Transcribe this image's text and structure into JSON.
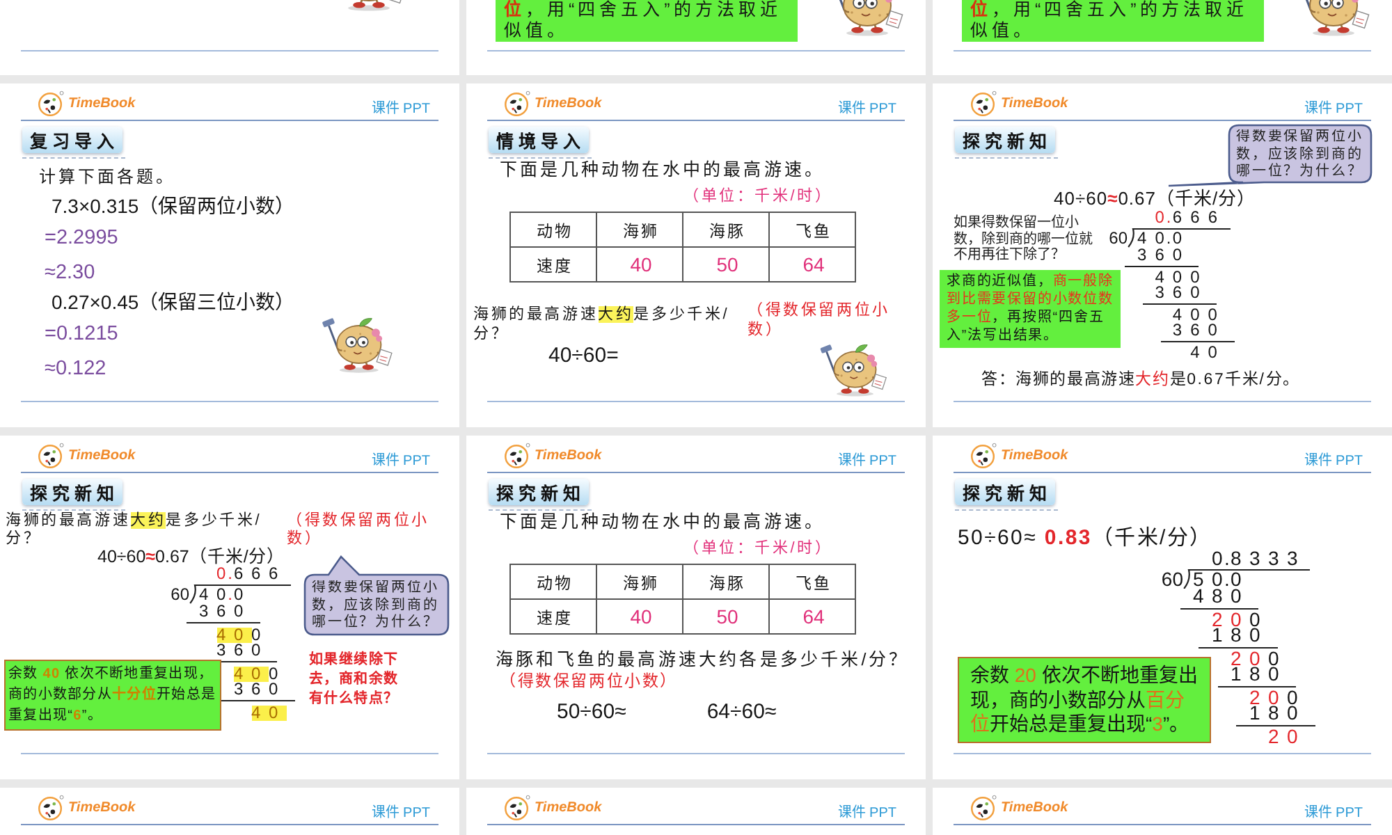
{
  "slides": [
    {
      "kind": "tail",
      "mascot": true
    },
    {
      "kind": "tail",
      "mascot": true,
      "note": {
        "text": "**位**，用“四舍五入”的方法取近似值。",
        "framed": false
      }
    },
    {
      "kind": "tail",
      "mascot": true,
      "note": {
        "text": "**位**，用“四舍五入”的方法取近似值。",
        "framed": false
      }
    },
    {
      "kind": "review",
      "logo": "TimeBook",
      "tag": "课件 PPT",
      "heading": "复习导入",
      "mascot": true,
      "lines": [
        {
          "kind": "prompt",
          "text": "计算下面各题。"
        },
        {
          "kind": "problem",
          "text": "7.3×0.315（保留两位小数）"
        },
        {
          "kind": "answer",
          "text": "=2.2995"
        },
        {
          "kind": "answer",
          "text": "≈2.30"
        },
        {
          "kind": "problem",
          "text": "0.27×0.45（保留三位小数）"
        },
        {
          "kind": "answer",
          "text": "=0.1215"
        },
        {
          "kind": "answer",
          "text": "≈0.122"
        }
      ]
    },
    {
      "kind": "scene",
      "logo": "TimeBook",
      "tag": "课件 PPT",
      "heading": "情境导入",
      "mascot": true,
      "intro": "下面是几种动物在水中的最高游速。",
      "unit": "（单位：千米/时）",
      "table": {
        "columns": [
          "动物",
          "海狮",
          "海豚",
          "飞鱼"
        ],
        "rows": [
          [
            "速度",
            "40",
            "50",
            "64"
          ]
        ]
      },
      "question": "海狮的最高游速**大约**是多少千米/分？",
      "hint": "（得数保留两位小数）",
      "equations": [
        "40÷60="
      ]
    },
    {
      "kind": "solution",
      "logo": "TimeBook",
      "tag": "课件 PPT",
      "heading": "探究新知",
      "bubble": "得数要保留两位小数，应该除到商的哪一位？为什么？",
      "equation": "40÷60**≈**0.67（千米/分）",
      "aside": "如果得数保留一位小数，除到商的哪一位就不用再往下除了？",
      "division": {
        "divisor": "60",
        "dividend": "40.0",
        "quotient": "**0.**666",
        "rows": [
          {
            "kind": "product",
            "digits": "360"
          },
          {
            "kind": "carry",
            "digits": "400"
          },
          {
            "kind": "product",
            "digits": "360"
          },
          {
            "kind": "carry",
            "digits": "400"
          },
          {
            "kind": "product",
            "digits": "360"
          },
          {
            "kind": "rest",
            "digits": "40"
          }
        ]
      },
      "note": {
        "text": "求商的近似值，**商一般除到比需要保留的小数位数多一位**，再按照“四舍五入”法写出结果。",
        "framed": false
      },
      "answer": "答：海狮的最高游速**大约**是0.67千米/分。"
    },
    {
      "kind": "pattern",
      "logo": "TimeBook",
      "tag": "课件 PPT",
      "heading": "探究新知",
      "question": "海狮的最高游速**大约**是多少千米/分？",
      "hint": "（得数保留两位小数）",
      "equation": "40÷60**≈**0.67（千米/分）",
      "bubble": "得数要保留两位小数，应该除到商的哪一位？为什么？",
      "division": {
        "divisor": "60",
        "dividend": "40**.**0",
        "quotient": "**0.**666",
        "rows": [
          {
            "kind": "product",
            "digits": "360"
          },
          {
            "kind": "carry",
            "digits": "**40**0"
          },
          {
            "kind": "product",
            "digits": "360"
          },
          {
            "kind": "carry",
            "digits": "**40**0"
          },
          {
            "kind": "product",
            "digits": "360"
          },
          {
            "kind": "rest",
            "digits": "40"
          }
        ]
      },
      "note": {
        "text": "余数 **40** 依次不断地重复出现，商的小数部分从**十分位**开始总是重复出现“**6**”。",
        "framed": true
      },
      "aside": "如果继续除下去，商和余数有什么特点？"
    },
    {
      "kind": "practice",
      "logo": "TimeBook",
      "tag": "课件 PPT",
      "heading": "探究新知",
      "intro": "下面是几种动物在水中的最高游速。",
      "unit": "（单位：千米/时）",
      "table": {
        "columns": [
          "动物",
          "海狮",
          "海豚",
          "飞鱼"
        ],
        "rows": [
          [
            "速度",
            "40",
            "50",
            "64"
          ]
        ]
      },
      "question": "海豚和飞鱼的最高游速大约各是多少千米/分？",
      "hint": "（得数保留两位小数）",
      "equations": [
        "50÷60≈",
        "64÷60≈"
      ]
    },
    {
      "kind": "result",
      "logo": "TimeBook",
      "tag": "课件 PPT",
      "heading": "探究新知",
      "equation": "50÷60≈ **0.83**（千米/分）",
      "division": {
        "divisor": "60",
        "dividend": "50.0",
        "quotient": "0.8333",
        "rows": [
          {
            "kind": "product",
            "digits": "480"
          },
          {
            "kind": "carry",
            "digits": "**20**0"
          },
          {
            "kind": "product",
            "digits": "180"
          },
          {
            "kind": "carry",
            "digits": "**20**0"
          },
          {
            "kind": "product",
            "digits": "180"
          },
          {
            "kind": "carry",
            "digits": "**20**0"
          },
          {
            "kind": "product",
            "digits": "180"
          },
          {
            "kind": "rest",
            "digits": "20"
          }
        ]
      },
      "note": {
        "text": "余数 **20** 依次不断地重复出现，商的小数部分从**百分位**开始总是重复出现“**3**”。",
        "framed": true
      }
    },
    {
      "kind": "header",
      "logo": "TimeBook",
      "tag": "课件 PPT"
    },
    {
      "kind": "header",
      "logo": "TimeBook",
      "tag": "课件 PPT"
    },
    {
      "kind": "header",
      "logo": "TimeBook",
      "tag": "课件 PPT"
    }
  ]
}
